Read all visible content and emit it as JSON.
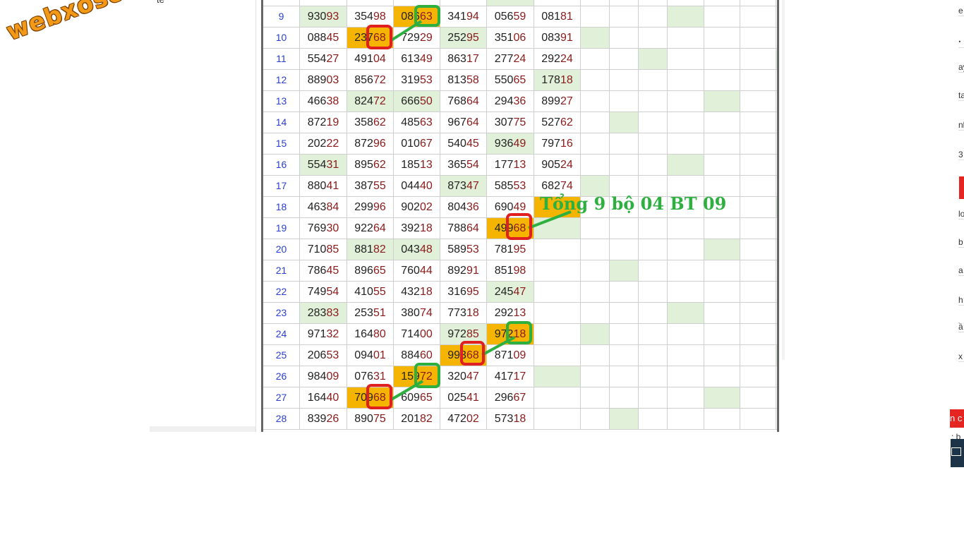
{
  "logo_text": "webxoso.net",
  "left_top_text": "té",
  "caption": "Tổng 9 bộ 04 BT 09",
  "rows": [
    {
      "idx": "",
      "cells": [
        {
          "v": "",
          "t": "",
          "bg": "white"
        },
        {
          "v": "",
          "t": "",
          "bg": "white"
        },
        {
          "v": "",
          "t": "",
          "bg": "white"
        },
        {
          "v": "",
          "t": "",
          "bg": "white"
        },
        {
          "v": "",
          "t": "",
          "bg": "green"
        },
        {
          "v": "",
          "t": "",
          "bg": "white"
        }
      ],
      "g": [
        false,
        false,
        false,
        false,
        false,
        false,
        false
      ]
    },
    {
      "idx": "9",
      "cells": [
        {
          "v": "930",
          "t": "93",
          "bg": "green"
        },
        {
          "v": "354",
          "t": "98",
          "bg": "white"
        },
        {
          "v": "086",
          "t": "63",
          "bg": "orange"
        },
        {
          "v": "341",
          "t": "94",
          "bg": "white"
        },
        {
          "v": "056",
          "t": "59",
          "bg": "white"
        },
        {
          "v": "081",
          "t": "81",
          "bg": "white"
        }
      ],
      "g": [
        false,
        false,
        false,
        true,
        false,
        false,
        false
      ]
    },
    {
      "idx": "10",
      "cells": [
        {
          "v": "088",
          "t": "45",
          "bg": "white"
        },
        {
          "v": "237",
          "t": "68",
          "bg": "orange"
        },
        {
          "v": "729",
          "t": "29",
          "bg": "white"
        },
        {
          "v": "252",
          "t": "95",
          "bg": "green"
        },
        {
          "v": "351",
          "t": "06",
          "bg": "white"
        },
        {
          "v": "083",
          "t": "91",
          "bg": "white"
        }
      ],
      "g": [
        true,
        false,
        false,
        false,
        false,
        false,
        false
      ]
    },
    {
      "idx": "11",
      "cells": [
        {
          "v": "554",
          "t": "27",
          "bg": "white"
        },
        {
          "v": "491",
          "t": "04",
          "bg": "white"
        },
        {
          "v": "613",
          "t": "49",
          "bg": "white"
        },
        {
          "v": "863",
          "t": "17",
          "bg": "white"
        },
        {
          "v": "277",
          "t": "24",
          "bg": "white"
        },
        {
          "v": "292",
          "t": "24",
          "bg": "white"
        }
      ],
      "g": [
        false,
        false,
        true,
        false,
        false,
        false,
        true
      ]
    },
    {
      "idx": "12",
      "cells": [
        {
          "v": "889",
          "t": "03",
          "bg": "white"
        },
        {
          "v": "856",
          "t": "72",
          "bg": "white"
        },
        {
          "v": "319",
          "t": "53",
          "bg": "white"
        },
        {
          "v": "813",
          "t": "58",
          "bg": "white"
        },
        {
          "v": "550",
          "t": "65",
          "bg": "white"
        },
        {
          "v": "178",
          "t": "18",
          "bg": "green"
        }
      ],
      "g": [
        false,
        false,
        false,
        false,
        false,
        false,
        false
      ]
    },
    {
      "idx": "13",
      "cells": [
        {
          "v": "466",
          "t": "38",
          "bg": "white"
        },
        {
          "v": "824",
          "t": "72",
          "bg": "green"
        },
        {
          "v": "666",
          "t": "50",
          "bg": "green"
        },
        {
          "v": "768",
          "t": "64",
          "bg": "white"
        },
        {
          "v": "294",
          "t": "36",
          "bg": "white"
        },
        {
          "v": "899",
          "t": "27",
          "bg": "white"
        }
      ],
      "g": [
        false,
        false,
        false,
        false,
        true,
        false,
        false
      ]
    },
    {
      "idx": "14",
      "cells": [
        {
          "v": "872",
          "t": "19",
          "bg": "white"
        },
        {
          "v": "358",
          "t": "62",
          "bg": "white"
        },
        {
          "v": "485",
          "t": "63",
          "bg": "white"
        },
        {
          "v": "967",
          "t": "64",
          "bg": "white"
        },
        {
          "v": "307",
          "t": "75",
          "bg": "white"
        },
        {
          "v": "527",
          "t": "62",
          "bg": "white"
        }
      ],
      "g": [
        false,
        true,
        false,
        false,
        false,
        false,
        false
      ]
    },
    {
      "idx": "15",
      "cells": [
        {
          "v": "202",
          "t": "22",
          "bg": "white"
        },
        {
          "v": "872",
          "t": "96",
          "bg": "white"
        },
        {
          "v": "010",
          "t": "67",
          "bg": "white"
        },
        {
          "v": "540",
          "t": "45",
          "bg": "white"
        },
        {
          "v": "936",
          "t": "49",
          "bg": "green"
        },
        {
          "v": "797",
          "t": "16",
          "bg": "white"
        }
      ],
      "g": [
        false,
        false,
        false,
        false,
        false,
        false,
        false
      ]
    },
    {
      "idx": "16",
      "cells": [
        {
          "v": "554",
          "t": "31",
          "bg": "green"
        },
        {
          "v": "895",
          "t": "62",
          "bg": "white"
        },
        {
          "v": "185",
          "t": "13",
          "bg": "white"
        },
        {
          "v": "365",
          "t": "54",
          "bg": "white"
        },
        {
          "v": "177",
          "t": "13",
          "bg": "white"
        },
        {
          "v": "905",
          "t": "24",
          "bg": "white"
        }
      ],
      "g": [
        false,
        false,
        false,
        true,
        false,
        false,
        false
      ]
    },
    {
      "idx": "17",
      "cells": [
        {
          "v": "880",
          "t": "41",
          "bg": "white"
        },
        {
          "v": "387",
          "t": "55",
          "bg": "white"
        },
        {
          "v": "044",
          "t": "40",
          "bg": "white"
        },
        {
          "v": "873",
          "t": "47",
          "bg": "green"
        },
        {
          "v": "585",
          "t": "53",
          "bg": "white"
        },
        {
          "v": "682",
          "t": "74",
          "bg": "white"
        }
      ],
      "g": [
        true,
        false,
        false,
        false,
        false,
        false,
        false
      ]
    },
    {
      "idx": "18",
      "cells": [
        {
          "v": "463",
          "t": "84",
          "bg": "white"
        },
        {
          "v": "299",
          "t": "96",
          "bg": "white"
        },
        {
          "v": "902",
          "t": "02",
          "bg": "white"
        },
        {
          "v": "804",
          "t": "36",
          "bg": "white"
        },
        {
          "v": "690",
          "t": "49",
          "bg": "white"
        },
        {
          "v": "",
          "t": "",
          "bg": "orange"
        }
      ],
      "g": [
        false,
        false,
        false,
        false,
        false,
        false,
        true
      ]
    },
    {
      "idx": "19",
      "cells": [
        {
          "v": "769",
          "t": "30",
          "bg": "white"
        },
        {
          "v": "922",
          "t": "64",
          "bg": "white"
        },
        {
          "v": "392",
          "t": "18",
          "bg": "white"
        },
        {
          "v": "788",
          "t": "64",
          "bg": "white"
        },
        {
          "v": "499",
          "t": "68",
          "bg": "orange"
        },
        {
          "v": "",
          "t": "",
          "bg": "green"
        }
      ],
      "g": [
        false,
        false,
        false,
        false,
        false,
        false,
        false
      ]
    },
    {
      "idx": "20",
      "cells": [
        {
          "v": "710",
          "t": "85",
          "bg": "white"
        },
        {
          "v": "881",
          "t": "82",
          "bg": "green"
        },
        {
          "v": "043",
          "t": "48",
          "bg": "green"
        },
        {
          "v": "589",
          "t": "53",
          "bg": "white"
        },
        {
          "v": "781",
          "t": "95",
          "bg": "white"
        },
        {
          "v": "",
          "t": "",
          "bg": "white"
        }
      ],
      "g": [
        false,
        false,
        false,
        false,
        true,
        false,
        false
      ]
    },
    {
      "idx": "21",
      "cells": [
        {
          "v": "786",
          "t": "45",
          "bg": "white"
        },
        {
          "v": "896",
          "t": "65",
          "bg": "white"
        },
        {
          "v": "760",
          "t": "44",
          "bg": "white"
        },
        {
          "v": "892",
          "t": "91",
          "bg": "white"
        },
        {
          "v": "851",
          "t": "98",
          "bg": "white"
        },
        {
          "v": "",
          "t": "",
          "bg": "white"
        }
      ],
      "g": [
        false,
        true,
        false,
        false,
        false,
        false,
        false
      ]
    },
    {
      "idx": "22",
      "cells": [
        {
          "v": "749",
          "t": "54",
          "bg": "white"
        },
        {
          "v": "410",
          "t": "55",
          "bg": "white"
        },
        {
          "v": "432",
          "t": "18",
          "bg": "white"
        },
        {
          "v": "316",
          "t": "95",
          "bg": "white"
        },
        {
          "v": "245",
          "t": "47",
          "bg": "green"
        },
        {
          "v": "",
          "t": "",
          "bg": "white"
        }
      ],
      "g": [
        false,
        false,
        false,
        false,
        false,
        false,
        false
      ]
    },
    {
      "idx": "23",
      "cells": [
        {
          "v": "283",
          "t": "83",
          "bg": "green"
        },
        {
          "v": "253",
          "t": "51",
          "bg": "white"
        },
        {
          "v": "380",
          "t": "74",
          "bg": "white"
        },
        {
          "v": "773",
          "t": "18",
          "bg": "white"
        },
        {
          "v": "292",
          "t": "13",
          "bg": "white"
        },
        {
          "v": "",
          "t": "",
          "bg": "white"
        }
      ],
      "g": [
        false,
        false,
        false,
        true,
        false,
        false,
        false
      ]
    },
    {
      "idx": "24",
      "cells": [
        {
          "v": "971",
          "t": "32",
          "bg": "white"
        },
        {
          "v": "164",
          "t": "80",
          "bg": "white"
        },
        {
          "v": "714",
          "t": "00",
          "bg": "white"
        },
        {
          "v": "972",
          "t": "85",
          "bg": "green"
        },
        {
          "v": "972",
          "t": "18",
          "bg": "orange"
        },
        {
          "v": "",
          "t": "",
          "bg": "white"
        }
      ],
      "g": [
        true,
        false,
        false,
        false,
        false,
        false,
        false
      ]
    },
    {
      "idx": "25",
      "cells": [
        {
          "v": "206",
          "t": "53",
          "bg": "white"
        },
        {
          "v": "094",
          "t": "01",
          "bg": "white"
        },
        {
          "v": "884",
          "t": "60",
          "bg": "white"
        },
        {
          "v": "993",
          "t": "68",
          "bg": "orange"
        },
        {
          "v": "871",
          "t": "09",
          "bg": "white"
        },
        {
          "v": "",
          "t": "",
          "bg": "white"
        }
      ],
      "g": [
        false,
        false,
        false,
        false,
        false,
        false,
        true
      ]
    },
    {
      "idx": "26",
      "cells": [
        {
          "v": "984",
          "t": "09",
          "bg": "white"
        },
        {
          "v": "076",
          "t": "31",
          "bg": "white"
        },
        {
          "v": "159",
          "t": "72",
          "bg": "orange"
        },
        {
          "v": "320",
          "t": "47",
          "bg": "white"
        },
        {
          "v": "417",
          "t": "17",
          "bg": "white"
        },
        {
          "v": "",
          "t": "",
          "bg": "green"
        }
      ],
      "g": [
        false,
        false,
        false,
        false,
        false,
        false,
        false
      ]
    },
    {
      "idx": "27",
      "cells": [
        {
          "v": "164",
          "t": "40",
          "bg": "white"
        },
        {
          "v": "709",
          "t": "68",
          "bg": "orange"
        },
        {
          "v": "609",
          "t": "65",
          "bg": "white"
        },
        {
          "v": "025",
          "t": "41",
          "bg": "white"
        },
        {
          "v": "296",
          "t": "67",
          "bg": "white"
        },
        {
          "v": "",
          "t": "",
          "bg": "white"
        }
      ],
      "g": [
        false,
        false,
        false,
        false,
        true,
        false,
        false
      ]
    },
    {
      "idx": "28",
      "cells": [
        {
          "v": "839",
          "t": "26",
          "bg": "white"
        },
        {
          "v": "890",
          "t": "75",
          "bg": "white"
        },
        {
          "v": "201",
          "t": "82",
          "bg": "white"
        },
        {
          "v": "472",
          "t": "02",
          "bg": "white"
        },
        {
          "v": "573",
          "t": "18",
          "bg": "white"
        },
        {
          "v": "",
          "t": "",
          "bg": "white"
        }
      ],
      "g": [
        false,
        true,
        false,
        false,
        false,
        false,
        false
      ]
    }
  ],
  "right_edge_letters": [
    "e",
    "ꞏ",
    "ay",
    "ta",
    "nh",
    "3",
    "lo",
    "b",
    "a",
    "h",
    "ầ",
    "x"
  ],
  "right_edge_bottom": "n c",
  "right_edge_bottom2": ": b",
  "colors": {
    "highlight_orange": "#f5b400",
    "highlight_green": "#e1f0d9",
    "ring_red": "#e02020",
    "ring_green": "#2db040",
    "caption_green": "#2db040",
    "index_blue": "#2a3fd0",
    "tail_red": "#8b1a1a"
  },
  "icons": [
    "monitor-icon"
  ]
}
